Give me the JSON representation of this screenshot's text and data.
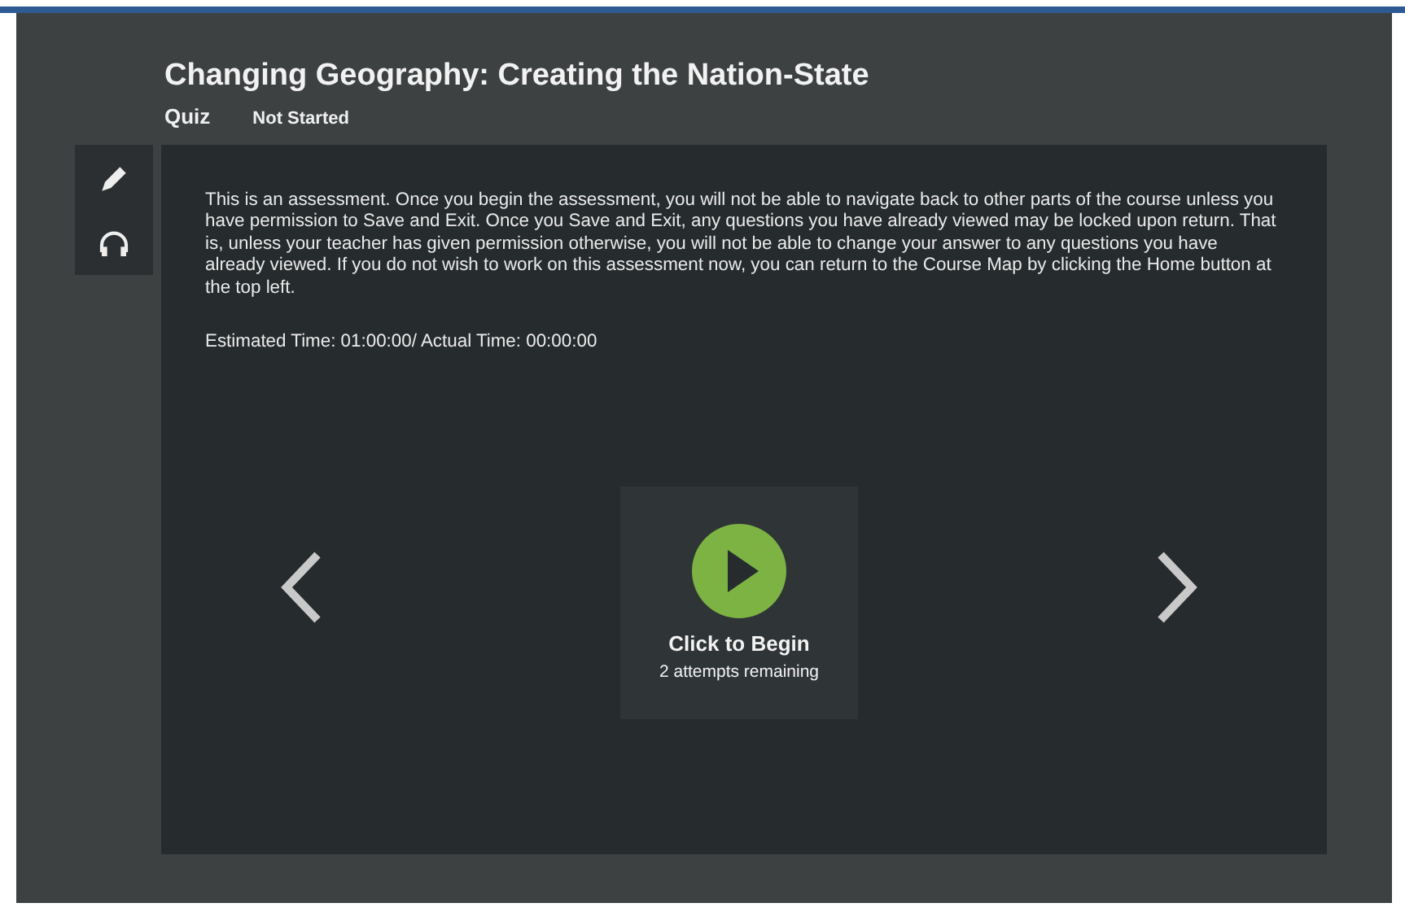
{
  "header": {
    "title": "Changing Geography: Creating the Nation-State",
    "type": "Quiz",
    "status": "Not Started"
  },
  "tools": [
    {
      "kind": "pencil"
    },
    {
      "kind": "headphones"
    }
  ],
  "content": {
    "instructions": "This is an assessment. Once you begin the assessment, you will not be able to navigate back to other parts of the course unless you have permission to Save and Exit. Once you Save and Exit, any questions you have already viewed may be locked upon return. That is, unless your teacher has given permission otherwise, you will not be able to change your answer to any questions you have already viewed. If you do not wish to work on this assessment now, you can return to the Course Map by clicking the Home button at the top left.",
    "time": "Estimated Time: 01:00:00/ Actual Time: 00:00:00"
  },
  "begin": {
    "label": "Click to Begin",
    "attempts": "2 attempts remaining"
  }
}
